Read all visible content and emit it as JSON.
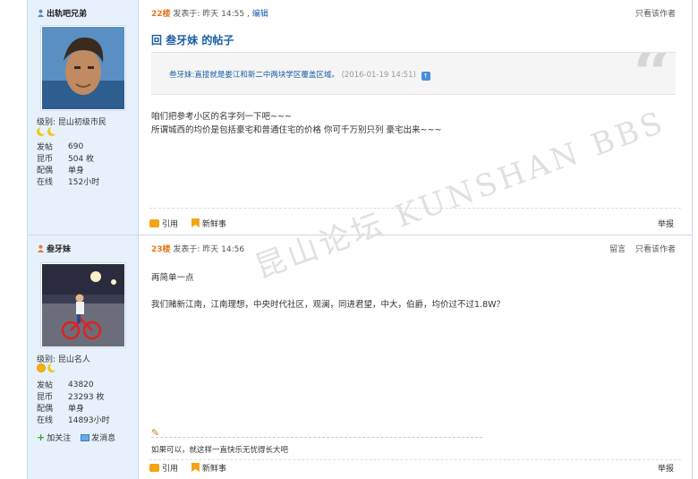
{
  "post1": {
    "username": "出轨吧兄弟",
    "level": "级别: 昆山初级市民",
    "stats": [
      {
        "key": "发帖",
        "value": "690"
      },
      {
        "key": "昆币",
        "value": "504 枚"
      },
      {
        "key": "配偶",
        "value": "单身"
      },
      {
        "key": "在线",
        "value": "152小时"
      }
    ],
    "floor": "22楼",
    "posted": "发表于: 昨天 14:55 ,",
    "edit": "编辑",
    "view_author_only": "只看该作者",
    "title": "回 叁牙妹 的帖子",
    "quote_text": "叁牙妹:直接就是娄江和新二中两块学区覆盖区域。",
    "quote_time": "(2016-01-19 14:51)",
    "body": [
      "咱们把参考小区的名字列一下吧~~~",
      "所谓城西的均价是包括豪宅和普通住宅的价格 你可千万别只列 豪宅出来~~~"
    ],
    "quote_action": "引用",
    "fresh_action": "新鲜事",
    "report": "举报"
  },
  "post2": {
    "username": "叁牙妹",
    "level": "级别: 昆山名人",
    "stats": [
      {
        "key": "发帖",
        "value": "43820"
      },
      {
        "key": "昆币",
        "value": "23293 枚"
      },
      {
        "key": "配偶",
        "value": "单身"
      },
      {
        "key": "在线",
        "value": "14893小时"
      }
    ],
    "follow": "加关注",
    "message": "发消息",
    "floor": "23楼",
    "posted": "发表于: 昨天 14:56",
    "leave_msg": "留言",
    "view_author_only": "只看该作者",
    "body": [
      "再简单一点",
      "我们赌新江南，江南理想，中央时代社区，观澜，同进君望，中大，伯爵，均价过不过1.8W？"
    ],
    "signature": "如果可以，就这样一直快乐无忧得长大吧",
    "quote_action": "引用",
    "fresh_action": "新鲜事",
    "report": "举报"
  },
  "watermark": "昆山论坛 KUNSHAN BBS",
  "colors": {
    "link": "#1a5fa6",
    "floor": "#e6751a",
    "sidebar": "#e7f1fb"
  }
}
